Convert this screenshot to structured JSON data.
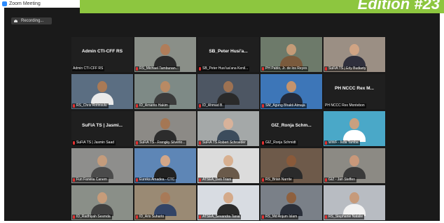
{
  "window": {
    "title": "Zoom Meeting"
  },
  "recording": {
    "icon": "record-icon",
    "label": "Recording..."
  },
  "banner": {
    "text": "Edition #23",
    "color": "#8dc63f"
  },
  "participants": [
    {
      "name": "Admin CTI-CFF RS",
      "display": "Admin CTI-CFF RS",
      "muted": false,
      "video": false,
      "active": true,
      "bg": "#1f1f1f",
      "skin": "#c79a74",
      "shirt": "#444"
    },
    {
      "name": "RS_Michael Tambunan...",
      "muted": true,
      "video": true,
      "bg": "#8a8f88",
      "skin": "#b07d5a",
      "shirt": "#2b2b2b"
    },
    {
      "name": "SB_Peter Husi'ua'ana Kenil...",
      "display": "SB_Peter Husi'a...",
      "muted": true,
      "video": false,
      "bg": "#1f1f1f"
    },
    {
      "name": "PH Pablo, Jr. de los Reyes",
      "muted": true,
      "video": true,
      "bg": "#6d7a6a",
      "skin": "#c49b77",
      "shirt": "#7a5a3c"
    },
    {
      "name": "SuFiA TS | Erly Budiarty",
      "muted": true,
      "video": true,
      "bg": "#9b8f84",
      "skin": "#d0a484",
      "shirt": "#2f2f3c"
    },
    {
      "name": "RS_Chris Rotinsulu",
      "muted": true,
      "video": true,
      "bg": "#5b6e82",
      "skin": "#a97a56",
      "shirt": "#eaeaea"
    },
    {
      "name": "ID_Arnanto Hakim",
      "muted": true,
      "video": true,
      "bg": "#7e8a86",
      "skin": "#b98a64",
      "shirt": "#3b3b3b"
    },
    {
      "name": "ID_Ahmad B.",
      "muted": true,
      "video": true,
      "bg": "#4d5663",
      "skin": "#9e7252",
      "shirt": "#2a2a2a"
    },
    {
      "name": "SM_Agung Bhakti Atmaja",
      "muted": true,
      "video": true,
      "bg": "#3d76b8",
      "skin": "#c3936d",
      "shirt": "#232a3a"
    },
    {
      "name": "PH NCCC Rex Montebon",
      "display": "PH NCCC Rex M...",
      "muted": false,
      "video": false,
      "bg": "#1f1f1f"
    },
    {
      "name": "SuFiA TS | Jasmin Saad",
      "display": "SuFiA TS | Jasmi...",
      "muted": true,
      "video": false,
      "bg": "#1f1f1f"
    },
    {
      "name": "SuFiA TS - Frengky Silverio...",
      "muted": true,
      "video": true,
      "bg": "#8c8a86",
      "skin": "#a57754",
      "shirt": "#2c2c2c"
    },
    {
      "name": "SuFiA TS Robert Schroeder",
      "muted": true,
      "video": true,
      "bg": "#a4a8a8",
      "skin": "#d8b29a",
      "shirt": "#3c4c5c"
    },
    {
      "name": "GIZ_Ronja Schmidt",
      "display": "GIZ_Ronja Schm...",
      "muted": true,
      "video": false,
      "bg": "#1f1f1f"
    },
    {
      "name": "WWF - Ikda Tamba",
      "muted": true,
      "video": true,
      "bg": "#4aa8c8",
      "skin": "#c8a080",
      "shirt": "#ffffff"
    },
    {
      "name": "Fun Fanelia Canem",
      "muted": true,
      "video": true,
      "bg": "#8e8e8c",
      "skin": "#c49c7c",
      "shirt": "#4b4b4b"
    },
    {
      "name": "Eureka Amadea - CTC",
      "muted": true,
      "video": true,
      "bg": "#5e86b6",
      "skin": "#d2a688",
      "shirt": "#222222"
    },
    {
      "name": "ATSEA_Deti Triani",
      "muted": true,
      "video": true,
      "bg": "#dcdcdc",
      "skin": "#d8b090",
      "shirt": "#6a5a4a"
    },
    {
      "name": "RS_Brian Narrite",
      "muted": true,
      "video": true,
      "bg": "#6e5a4a",
      "skin": "#8a5a3a",
      "shirt": "#2a2a2a"
    },
    {
      "name": "GIZ - Jan Steffen",
      "muted": true,
      "video": true,
      "bg": "#8c8a84",
      "skin": "#c8987a",
      "shirt": "#3a3a3a"
    },
    {
      "name": "ID_Radhiyah Sesmda",
      "muted": true,
      "video": true,
      "bg": "#8a8f88",
      "skin": "#c69c7a",
      "shirt": "#404040"
    },
    {
      "name": "ID_Aris Suharto",
      "muted": true,
      "video": true,
      "bg": "#9a8a74",
      "skin": "#a87a58",
      "shirt": "#334466"
    },
    {
      "name": "ATSEA_Sevandra Tania",
      "muted": true,
      "video": true,
      "bg": "#d8dce2",
      "skin": "#d4aa8a",
      "shirt": "#2b2b2b"
    },
    {
      "name": "RS_Md Anjum Islam",
      "muted": true,
      "video": true,
      "bg": "#7a8088",
      "skin": "#8e603e",
      "shirt": "#2a2f3a"
    },
    {
      "name": "RS_Stephanie Natalie",
      "muted": true,
      "video": true,
      "bg": "#b8bcc2",
      "skin": "#c69a7a",
      "shirt": "#f2f2f2"
    }
  ]
}
